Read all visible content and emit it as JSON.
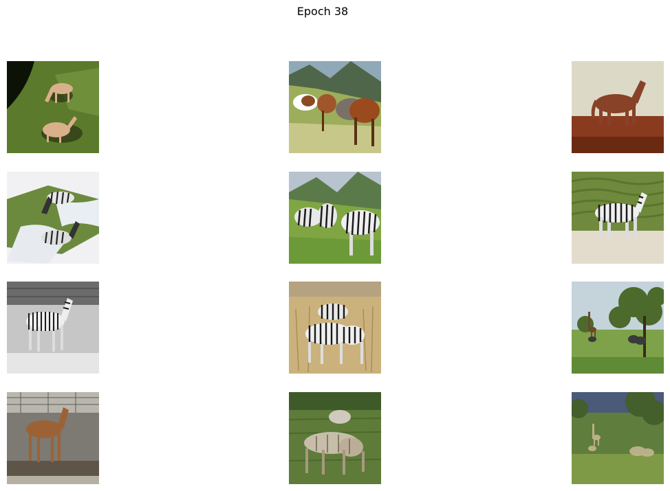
{
  "figure": {
    "title": "Epoch 38"
  },
  "grid": {
    "rows": 4,
    "columns": 3,
    "cells": [
      {
        "row": 0,
        "col": 0,
        "subject": "horse-image"
      },
      {
        "row": 0,
        "col": 1,
        "subject": "horse-image"
      },
      {
        "row": 0,
        "col": 2,
        "subject": "horse-image"
      },
      {
        "row": 1,
        "col": 0,
        "subject": "zebra-image"
      },
      {
        "row": 1,
        "col": 1,
        "subject": "zebra-image"
      },
      {
        "row": 1,
        "col": 2,
        "subject": "zebra-image"
      },
      {
        "row": 2,
        "col": 0,
        "subject": "zebra-image"
      },
      {
        "row": 2,
        "col": 1,
        "subject": "zebra-image"
      },
      {
        "row": 2,
        "col": 2,
        "subject": "zebra-image"
      },
      {
        "row": 3,
        "col": 0,
        "subject": "horse-image"
      },
      {
        "row": 3,
        "col": 1,
        "subject": "horse-image"
      },
      {
        "row": 3,
        "col": 2,
        "subject": "horse-image"
      }
    ]
  }
}
